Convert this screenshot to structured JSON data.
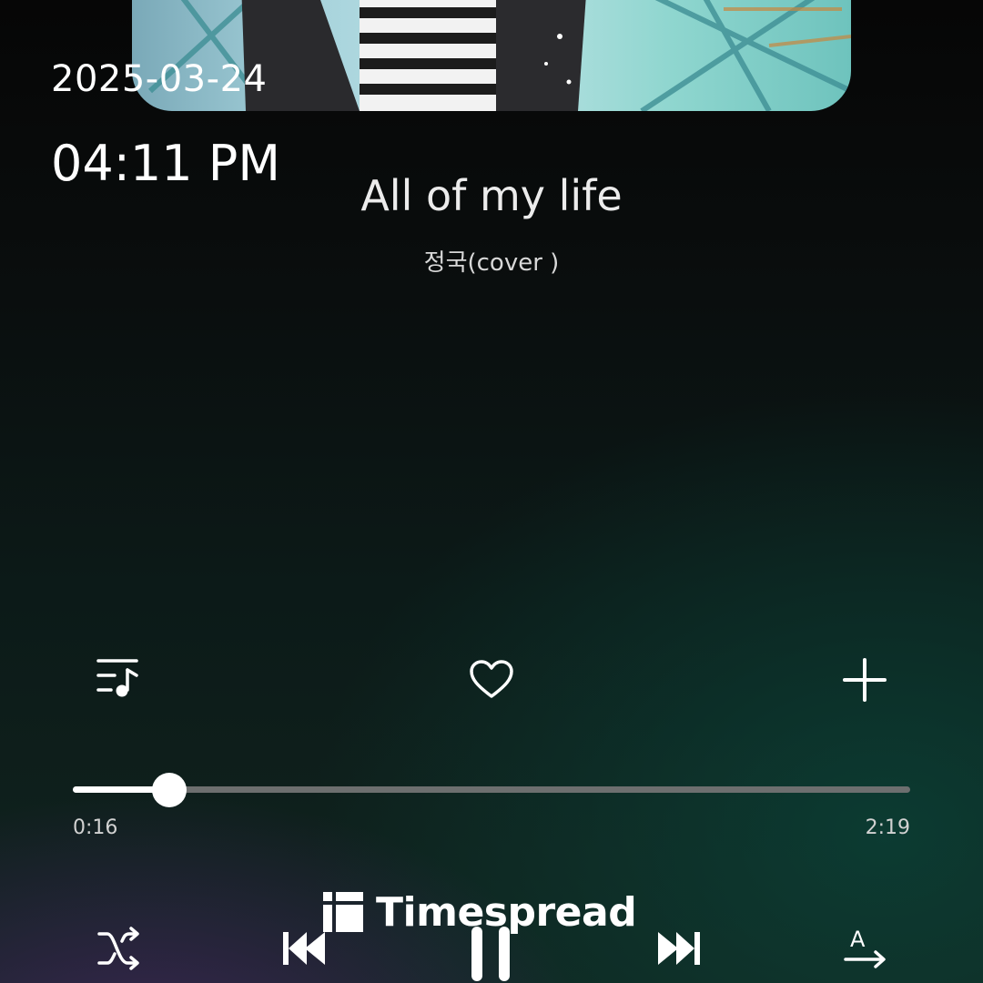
{
  "status": {
    "date": "2025-03-24",
    "time": "04:11 PM"
  },
  "now_playing": {
    "title": "All of my life",
    "artist": "정국(cover )"
  },
  "actions": {
    "playlist_icon": "playlist-music-icon",
    "favorite_icon": "heart-outline-icon",
    "add_icon": "plus-icon"
  },
  "progress": {
    "elapsed": "0:16",
    "total": "2:19",
    "fraction": 0.115
  },
  "controls": {
    "shuffle_icon": "shuffle-icon",
    "previous_icon": "skip-previous-icon",
    "play_pause_icon": "pause-icon",
    "next_icon": "skip-next-icon",
    "lyrics_translate_icon": "text-translate-icon"
  },
  "watermark": {
    "text": "Timespread"
  },
  "colors": {
    "text_primary": "#ffffff",
    "track": "#6d6f6f"
  }
}
